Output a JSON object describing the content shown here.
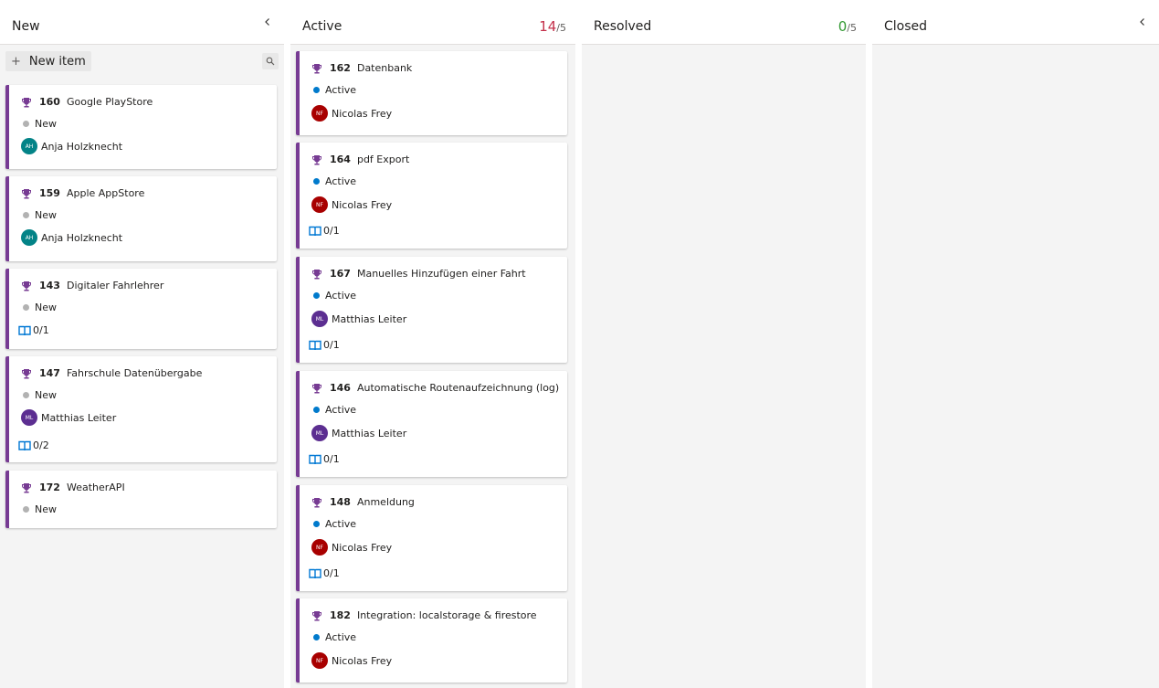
{
  "colors": {
    "accent_feature": "#773b93",
    "state_new": "#b2b2b2",
    "state_active": "#007acc",
    "count_over": "#c4314b",
    "count_ok": "#339933",
    "task_icon": "#0078d4"
  },
  "columns": [
    {
      "title": "New",
      "collapse_icon": "chevron-left-icon",
      "toolbar": {
        "new_item_label": "New item",
        "plus_icon": "+",
        "search_icon": "search-icon"
      },
      "cards": [
        {
          "id": "160",
          "title": "Google PlayStore",
          "state": "New",
          "assignee_initials": "AH",
          "assignee": "Anja Holzknecht",
          "avatar_color": "#038387"
        },
        {
          "id": "159",
          "title": "Apple AppStore",
          "state": "New",
          "assignee_initials": "AH",
          "assignee": "Anja Holzknecht",
          "avatar_color": "#038387"
        },
        {
          "id": "143",
          "title": "Digitaler Fahrlehrer",
          "state": "New",
          "tasks": "0/1"
        },
        {
          "id": "147",
          "title": "Fahrschule Datenübergabe",
          "state": "New",
          "assignee_initials": "ML",
          "assignee": "Matthias Leiter",
          "avatar_color": "#5c2e91",
          "tasks": "0/2"
        },
        {
          "id": "172",
          "title": "WeatherAPI",
          "state": "New"
        }
      ]
    },
    {
      "title": "Active",
      "count": "14",
      "limit": "/5",
      "cards": [
        {
          "id": "162",
          "title": "Datenbank",
          "state": "Active",
          "assignee_initials": "NF",
          "assignee": "Nicolas Frey",
          "avatar_color": "#a80000"
        },
        {
          "id": "164",
          "title": "pdf Export",
          "state": "Active",
          "assignee_initials": "NF",
          "assignee": "Nicolas Frey",
          "avatar_color": "#a80000",
          "tasks": "0/1"
        },
        {
          "id": "167",
          "title": "Manuelles Hinzufügen einer Fahrt",
          "state": "Active",
          "assignee_initials": "ML",
          "assignee": "Matthias Leiter",
          "avatar_color": "#5c2e91",
          "tasks": "0/1"
        },
        {
          "id": "146",
          "title": "Automatische Routenaufzeichnung (log)",
          "state": "Active",
          "assignee_initials": "ML",
          "assignee": "Matthias Leiter",
          "avatar_color": "#5c2e91",
          "tasks": "0/1"
        },
        {
          "id": "148",
          "title": "Anmeldung",
          "state": "Active",
          "assignee_initials": "NF",
          "assignee": "Nicolas Frey",
          "avatar_color": "#a80000",
          "tasks": "0/1"
        },
        {
          "id": "182",
          "title": "Integration: localstorage & firestore",
          "state": "Active",
          "assignee_initials": "NF",
          "assignee": "Nicolas Frey",
          "avatar_color": "#a80000"
        }
      ]
    },
    {
      "title": "Resolved",
      "count": "0",
      "limit": "/5",
      "cards": []
    },
    {
      "title": "Closed",
      "collapse_icon": "chevron-left-icon",
      "cards": []
    }
  ]
}
